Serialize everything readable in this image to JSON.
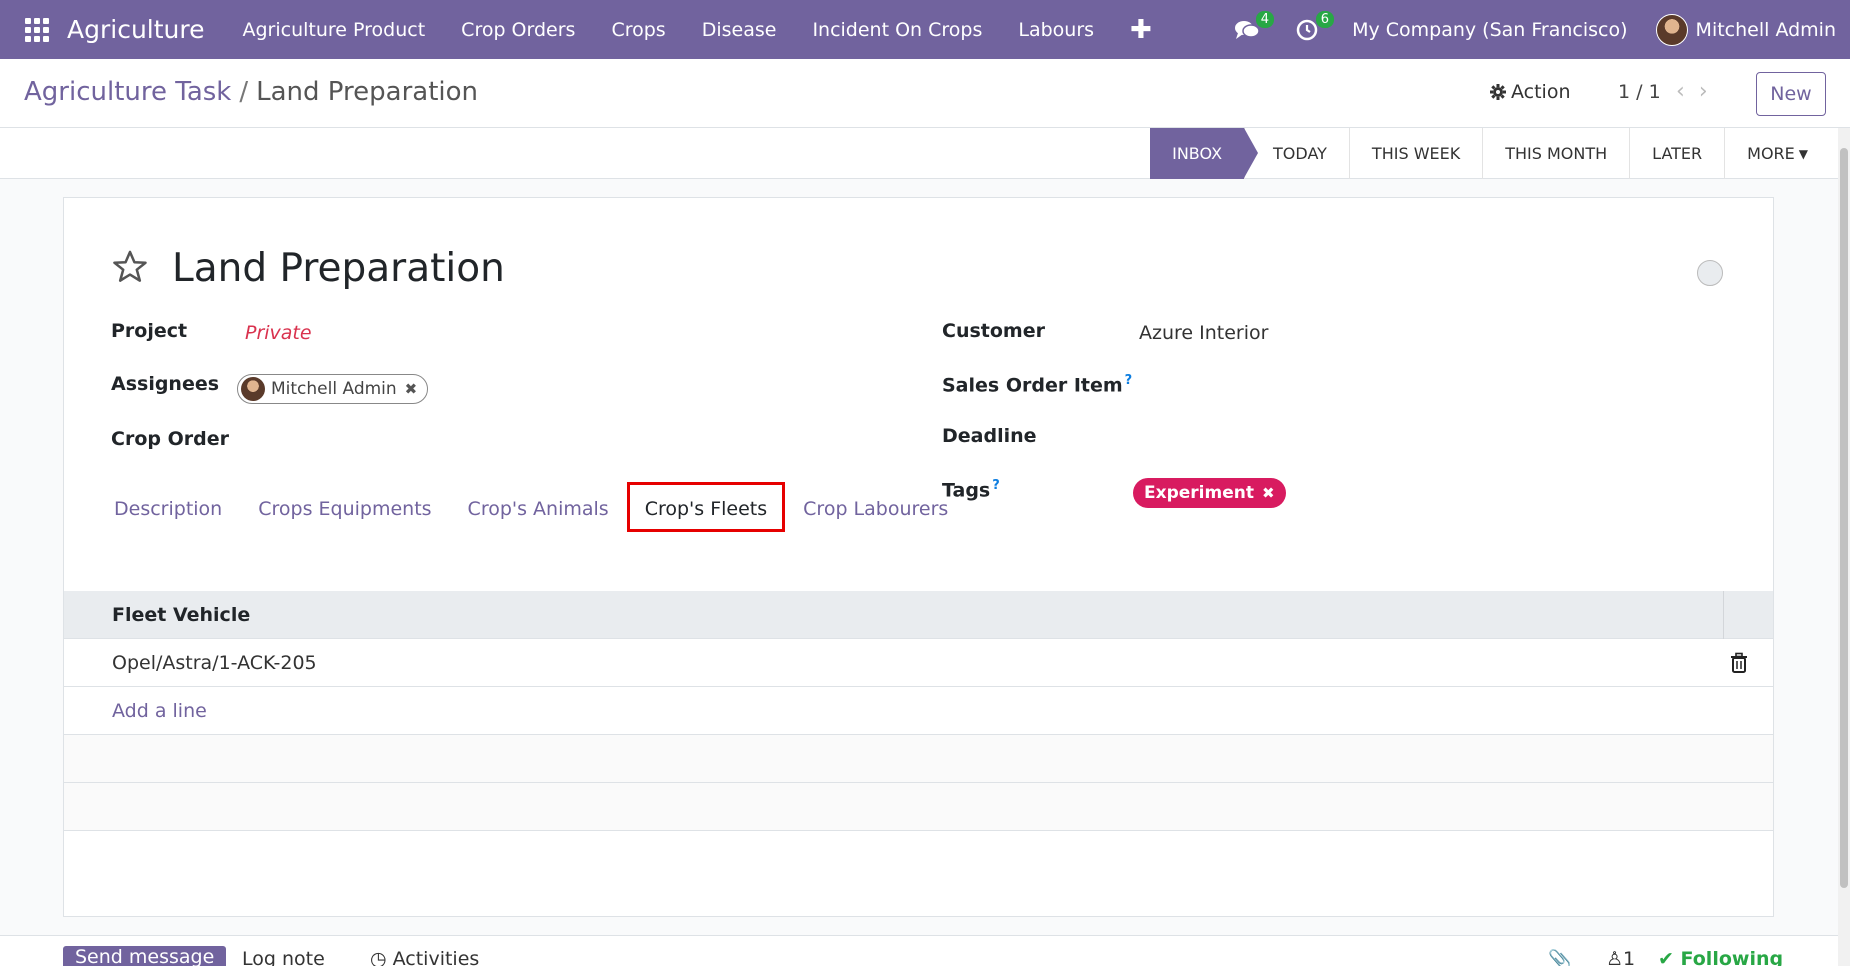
{
  "navbar": {
    "app_title": "Agriculture",
    "menu": [
      "Agriculture Product",
      "Crop Orders",
      "Crops",
      "Disease",
      "Incident On Crops",
      "Labours"
    ],
    "messages_count": "4",
    "activities_count": "6",
    "company": "My Company (San Francisco)",
    "user": "Mitchell Admin"
  },
  "control": {
    "breadcrumb_parent": "Agriculture Task",
    "breadcrumb_separator": "/",
    "breadcrumb_current": "Land Preparation",
    "action_label": "Action",
    "pager": "1 / 1",
    "new_label": "New"
  },
  "stages": [
    "INBOX",
    "TODAY",
    "THIS WEEK",
    "THIS MONTH",
    "LATER",
    "MORE"
  ],
  "form": {
    "title": "Land Preparation",
    "project_label": "Project",
    "project_value": "Private",
    "assignees_label": "Assignees",
    "assignee": "Mitchell Admin",
    "crop_order_label": "Crop Order",
    "customer_label": "Customer",
    "customer_value": "Azure Interior",
    "sales_order_item_label": "Sales Order Item",
    "deadline_label": "Deadline",
    "tags_label": "Tags",
    "tag": "Experiment",
    "help_mark": "?"
  },
  "tabs": [
    "Description",
    "Crops Equipments",
    "Crop's Animals",
    "Crop's Fleets",
    "Crop Labourers"
  ],
  "table": {
    "header": "Fleet Vehicle",
    "rows": [
      "Opel/Astra/1-ACK-205"
    ],
    "add_line": "Add a line"
  },
  "chatter": {
    "send_message": "Send message",
    "log_note": "Log note",
    "activities": "Activities",
    "followers_count": "1",
    "following": "Following"
  },
  "colors": {
    "primary": "#71639e",
    "tag": "#d81b60",
    "highlight": "#e60000"
  }
}
